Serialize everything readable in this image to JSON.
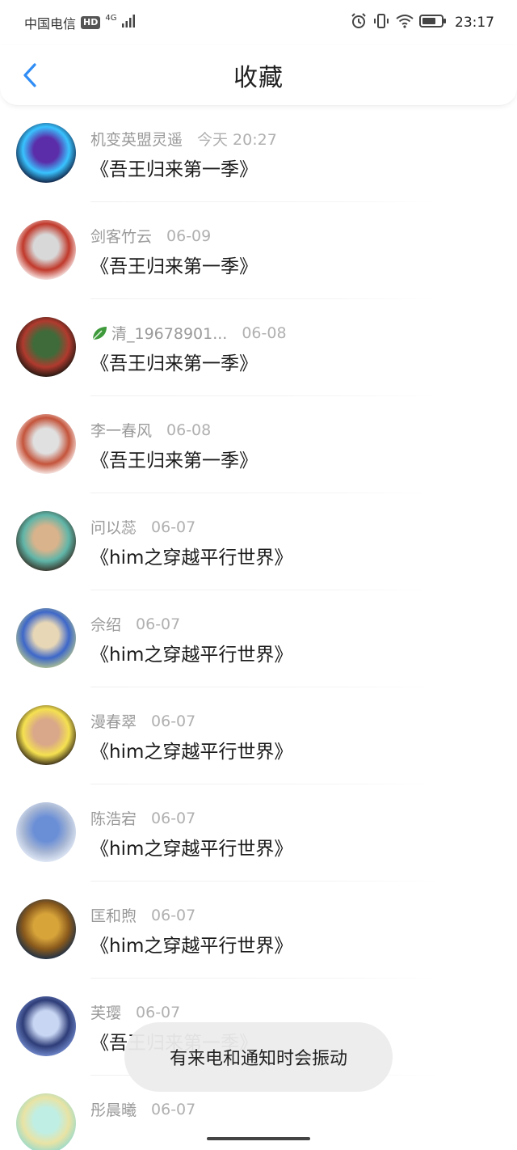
{
  "status_bar": {
    "carrier": "中国电信",
    "hd": "HD",
    "network": "4G",
    "time": "23:17"
  },
  "header": {
    "title": "收藏",
    "back_icon": "chevron-left-icon",
    "accent": "#2f8df5"
  },
  "items": [
    {
      "user": "机变英盟灵遥",
      "date": "今天 20:27",
      "title": "《吾王归来第一季》",
      "avatar_colors": [
        "#0b0b2a",
        "#5b2da8",
        "#39c3ff"
      ]
    },
    {
      "user": "剑客竹云",
      "date": "06-09",
      "title": "《吾王归来第一季》",
      "avatar_colors": [
        "#ffffff",
        "#d8d8d8",
        "#c0392b"
      ]
    },
    {
      "user": "清_19678901...",
      "date": "06-08",
      "title": "《吾王归来第一季》",
      "leaf": true,
      "avatar_colors": [
        "#0e140e",
        "#3f6b3a",
        "#b03a2e"
      ]
    },
    {
      "user": "李一春风",
      "date": "06-08",
      "title": "《吾王归来第一季》",
      "avatar_colors": [
        "#ffffff",
        "#e0e0e0",
        "#c4543b"
      ]
    },
    {
      "user": "问以蕊",
      "date": "06-07",
      "title": "《him之穿越平行世界》",
      "avatar_colors": [
        "#33261c",
        "#d9b38c",
        "#5fb5a8"
      ]
    },
    {
      "user": "佘绍",
      "date": "06-07",
      "title": "《him之穿越平行世界》",
      "avatar_colors": [
        "#b9c98e",
        "#e7d7b6",
        "#3d67c9"
      ]
    },
    {
      "user": "漫春翠",
      "date": "06-07",
      "title": "《him之穿越平行世界》",
      "avatar_colors": [
        "#1e1410",
        "#d9a789",
        "#f5e150"
      ]
    },
    {
      "user": "陈浩宕",
      "date": "06-07",
      "title": "《him之穿越平行世界》",
      "avatar_colors": [
        "#e9f0fb",
        "#6b8fd6",
        "#a8b7d4"
      ]
    },
    {
      "user": "匡和煦",
      "date": "06-07",
      "title": "《him之穿越平行世界》",
      "avatar_colors": [
        "#0e2a4c",
        "#d7a43a",
        "#8a5a1c"
      ]
    },
    {
      "user": "芙璎",
      "date": "06-07",
      "title": "《吾王归来第一季》",
      "avatar_colors": [
        "#7a93d6",
        "#c8d6f4",
        "#2e3d78"
      ]
    },
    {
      "user": "彤晨曦",
      "date": "06-07",
      "title": "",
      "avatar_colors": [
        "#8fd9d0",
        "#bfeee4",
        "#e9e3a4"
      ]
    }
  ],
  "toast": {
    "text": "有来电和通知时会振动"
  }
}
